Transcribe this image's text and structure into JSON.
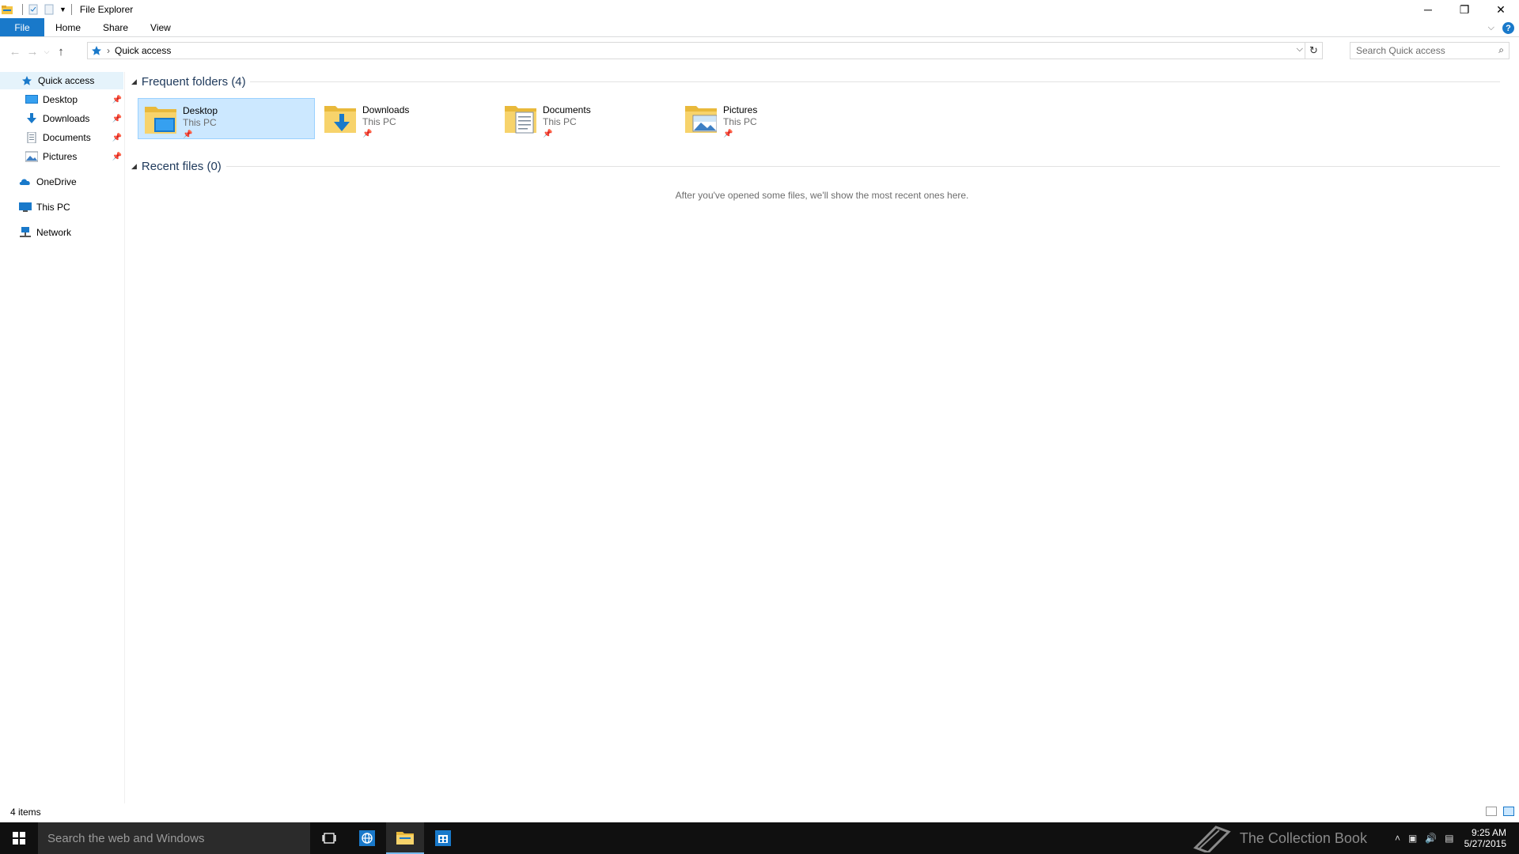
{
  "window": {
    "title": "File Explorer"
  },
  "ribbon": {
    "tabs": [
      "File",
      "Home",
      "Share",
      "View"
    ]
  },
  "address": {
    "location": "Quick access",
    "search_placeholder": "Search Quick access"
  },
  "sidebar": {
    "items": [
      {
        "label": "Quick access",
        "icon": "star-icon",
        "pinned": false
      },
      {
        "label": "Desktop",
        "icon": "desktop-icon",
        "pinned": true
      },
      {
        "label": "Downloads",
        "icon": "download-arrow-icon",
        "pinned": true
      },
      {
        "label": "Documents",
        "icon": "document-icon",
        "pinned": true
      },
      {
        "label": "Pictures",
        "icon": "picture-icon",
        "pinned": true
      },
      {
        "label": "OneDrive",
        "icon": "cloud-icon",
        "pinned": false
      },
      {
        "label": "This PC",
        "icon": "monitor-icon",
        "pinned": false
      },
      {
        "label": "Network",
        "icon": "network-icon",
        "pinned": false
      }
    ]
  },
  "main": {
    "frequent_header": "Frequent folders (4)",
    "folders": [
      {
        "name": "Desktop",
        "location": "This PC"
      },
      {
        "name": "Downloads",
        "location": "This PC"
      },
      {
        "name": "Documents",
        "location": "This PC"
      },
      {
        "name": "Pictures",
        "location": "This PC"
      }
    ],
    "recent_header": "Recent files (0)",
    "recent_empty": "After you've opened some files, we'll show the most recent ones here."
  },
  "status": {
    "items_count": "4 items"
  },
  "taskbar": {
    "search_placeholder": "Search the web and Windows",
    "watermark": "The Collection Book",
    "time": "9:25 AM",
    "date": "5/27/2015"
  },
  "colors": {
    "accent": "#1979ca",
    "selection": "#cce8ff",
    "taskbar": "#101010"
  }
}
